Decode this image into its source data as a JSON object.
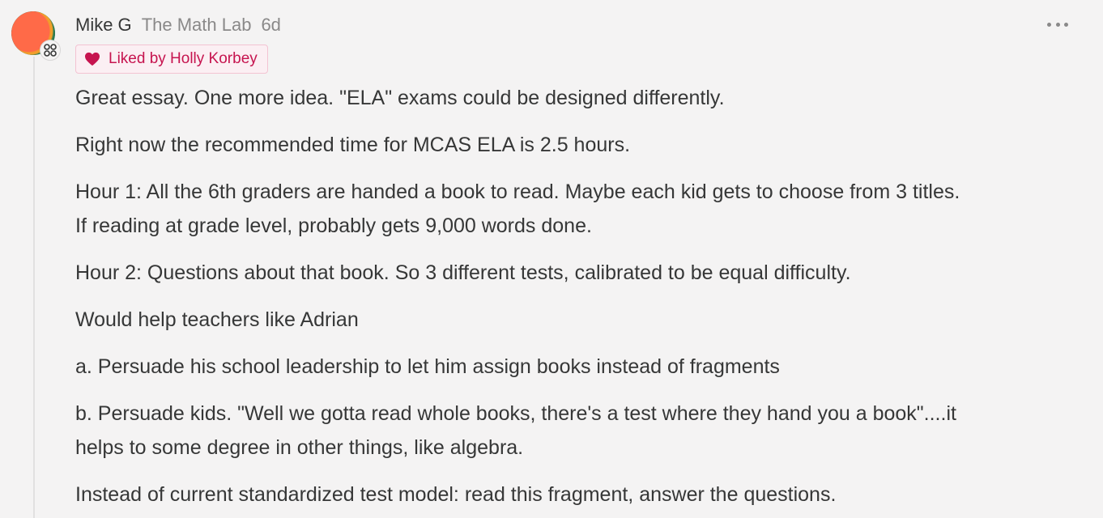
{
  "comment": {
    "author": "Mike G",
    "publication": "The Math Lab",
    "time": "6d",
    "liked_by": "Liked by Holly Korbey",
    "icons": {
      "avatar_badge": "publication-logo-icon",
      "like": "heart-icon",
      "more": "ellipsis-icon"
    },
    "colors": {
      "like_accent": "#c6144f",
      "avatar_primary": "#ff6a48"
    },
    "paragraphs": [
      [
        "Great essay. One more idea. \"ELA\" exams could be designed differently."
      ],
      [
        "Right now the recommended time for MCAS ELA is 2.5 hours."
      ],
      [
        "Hour 1: All the 6th graders are handed a book to read. Maybe each kid gets to choose from 3 titles.",
        "If reading at grade level, probably gets 9,000 words done."
      ],
      [
        "Hour 2: Questions about that book. So 3 different tests, calibrated to be equal difficulty."
      ],
      [
        "Would help teachers like Adrian"
      ],
      [
        "a. Persuade his school leadership to let him assign books instead of fragments"
      ],
      [
        "b. Persuade kids. \"Well we gotta read whole books, there's a test where they hand you a book\"....it",
        "helps to some degree in other things, like algebra."
      ],
      [
        "Instead of current standardized test model: read this fragment, answer the questions."
      ]
    ]
  }
}
